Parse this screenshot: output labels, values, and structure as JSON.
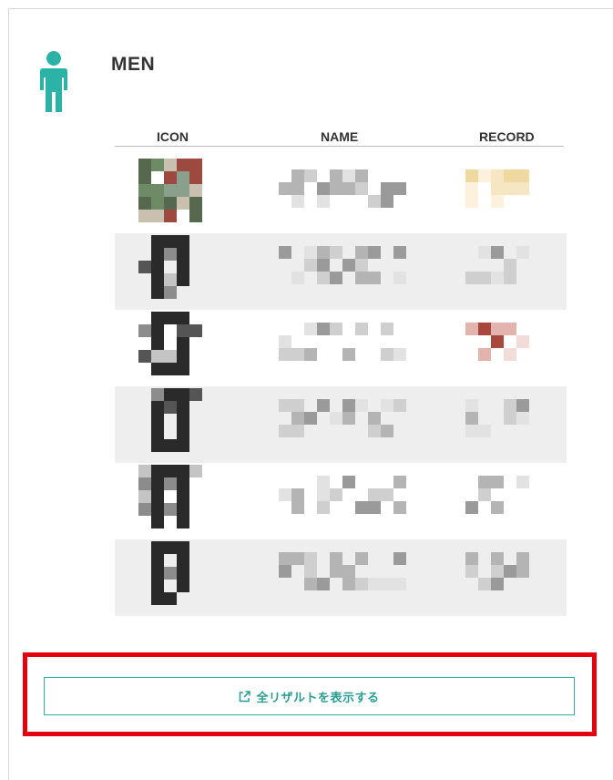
{
  "section": {
    "title": "MEN",
    "icon": "person-icon",
    "accent_color": "#2bb3a8"
  },
  "table": {
    "headers": {
      "icon": "ICON",
      "name": "NAME",
      "record": "RECORD"
    },
    "rows": [
      {
        "icon": "pixelated-avatar",
        "name": "",
        "record": ""
      },
      {
        "icon": "pixelated-avatar",
        "name": "",
        "record": ""
      },
      {
        "icon": "pixelated-avatar",
        "name": "",
        "record": ""
      },
      {
        "icon": "pixelated-avatar",
        "name": "",
        "record": ""
      },
      {
        "icon": "pixelated-avatar",
        "name": "",
        "record": ""
      },
      {
        "icon": "pixelated-avatar",
        "name": "",
        "record": ""
      }
    ]
  },
  "button": {
    "label": "全リザルトを表示する",
    "icon": "external-link-icon"
  },
  "highlight_color": "#e3000f"
}
